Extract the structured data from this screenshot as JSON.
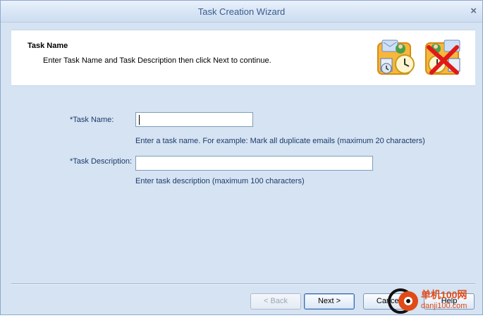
{
  "window": {
    "title": "Task Creation Wizard",
    "close_glyph": "×"
  },
  "header": {
    "title": "Task Name",
    "subtitle": "Enter Task Name and Task Description then click Next to continue.",
    "icons": [
      "task-schedule-icon",
      "task-delete-icon"
    ]
  },
  "form": {
    "task_name": {
      "label": "*Task Name:",
      "value": "",
      "hint": "Enter a task name. For example: Mark all duplicate emails (maximum 20 characters)"
    },
    "task_description": {
      "label": "*Task Description:",
      "value": "",
      "hint": "Enter task description (maximum 100 characters)"
    }
  },
  "buttons": {
    "back": "< Back",
    "next": "Next >",
    "cancel": "Cancel",
    "help": "Help"
  },
  "watermark": {
    "line1": "单机100网",
    "line2": "danji100.com"
  },
  "colors": {
    "accent": "#3c6aa8",
    "background": "#d5e3f2",
    "text": "#1c3a6b",
    "watermark": "#e04a17"
  }
}
